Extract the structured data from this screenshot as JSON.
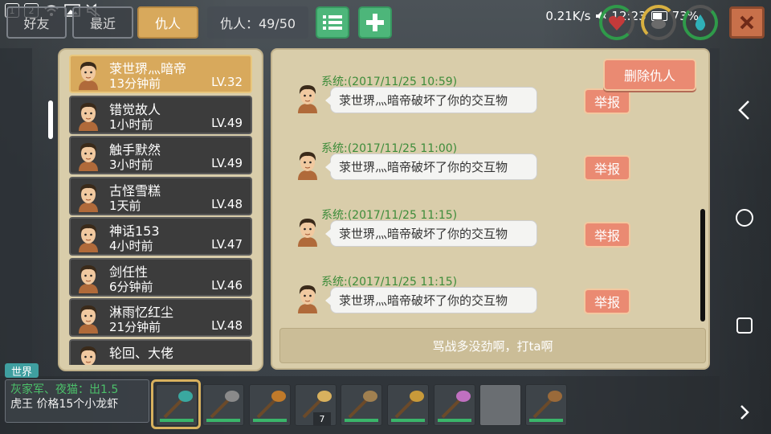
{
  "status": {
    "net_speed": "0.21K/s",
    "time": "12:23",
    "battery_percent": "73%",
    "battery_level": 0.73
  },
  "top_tabs": {
    "friends": "好友",
    "recent": "最近",
    "enemies": "仇人",
    "enemy_count": "仇人：49/50"
  },
  "enemy_list": [
    {
      "name": "莍世琾灬暗帝",
      "time": "13分钟前",
      "level": "LV.32",
      "selected": true
    },
    {
      "name": "错觉故人",
      "time": "1小时前",
      "level": "LV.49"
    },
    {
      "name": "触手默然",
      "time": "3小时前",
      "level": "LV.49"
    },
    {
      "name": "古怪雪糕",
      "time": "1天前",
      "level": "LV.48"
    },
    {
      "name": "神话153",
      "time": "4小时前",
      "level": "LV.47"
    },
    {
      "name": "剑任性",
      "time": "6分钟前",
      "level": "LV.46"
    },
    {
      "name": "淋雨忆红尘",
      "time": "21分钟前",
      "level": "LV.48"
    },
    {
      "name": "轮回、大佬",
      "time": "",
      "level": ""
    }
  ],
  "messages_panel": {
    "delete_label": "删除仇人",
    "report_label": "举报",
    "input_placeholder": "骂战多没劲啊，打ta啊",
    "messages": [
      {
        "sender": "系统:",
        "timestamp": "(2017/11/25 10:59)",
        "text": "莍世琾灬暗帝破坏了你的交互物"
      },
      {
        "sender": "系统:",
        "timestamp": "(2017/11/25 11:00)",
        "text": "莍世琾灬暗帝破坏了你的交互物"
      },
      {
        "sender": "系统:",
        "timestamp": "(2017/11/25 11:15)",
        "text": "莍世琾灬暗帝破坏了你的交互物"
      },
      {
        "sender": "系统:",
        "timestamp": "(2017/11/25 11:15)",
        "text": "莍世琾灬暗帝破坏了你的交互物"
      }
    ]
  },
  "world_chat": {
    "tag": "世界",
    "speaker": "灰家军、夜猫",
    "line1_rest": "：出1.5",
    "line2": "虎王  价格15个小龙虾"
  },
  "hotbar": {
    "slots": [
      "green-axe-icon",
      "pickaxe-icon",
      "gourd-icon",
      "golden-hammer-icon",
      "battle-axe-icon",
      "bow-icon",
      "crystal-sword-icon",
      "empty",
      "club-icon"
    ],
    "stack_count": "7",
    "colors": {
      "durability": "#3ab56a",
      "selected_frame": "#d8b15e"
    }
  },
  "colors": {
    "panel": "#d9cdaa",
    "selected": "#d8a95c",
    "report": "#ea8a72",
    "system_green": "#3d8c3a",
    "action_green": "#4db67a",
    "close": "#c8704a"
  }
}
